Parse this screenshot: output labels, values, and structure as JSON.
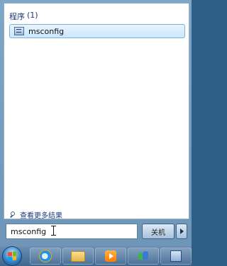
{
  "start_menu": {
    "group_header": {
      "label": "程序",
      "count": "(1)"
    },
    "results": [
      {
        "label": "msconfig",
        "icon": "msconfig-app-icon"
      }
    ],
    "see_more": {
      "label": "查看更多结果",
      "icon": "search-icon"
    },
    "search": {
      "value": "msconfig"
    },
    "shutdown_button": {
      "label": "关机"
    },
    "shutdown_menu_icon": "chevron-right-icon"
  },
  "taskbar": {
    "items": [
      {
        "name": "start-orb",
        "icon": "windows-logo-icon"
      },
      {
        "name": "internet-explorer",
        "icon": "ie-icon"
      },
      {
        "name": "libraries",
        "icon": "folder-icon"
      },
      {
        "name": "media-player",
        "icon": "play-icon"
      },
      {
        "name": "people-app",
        "icon": "people-icon"
      },
      {
        "name": "window-item",
        "icon": "window-icon"
      }
    ]
  },
  "colors": {
    "header_text": "#1e3a78",
    "highlight_border": "#7fb0e0",
    "highlight_fill": "#cde6fb",
    "taskbar": "#3e668f"
  }
}
